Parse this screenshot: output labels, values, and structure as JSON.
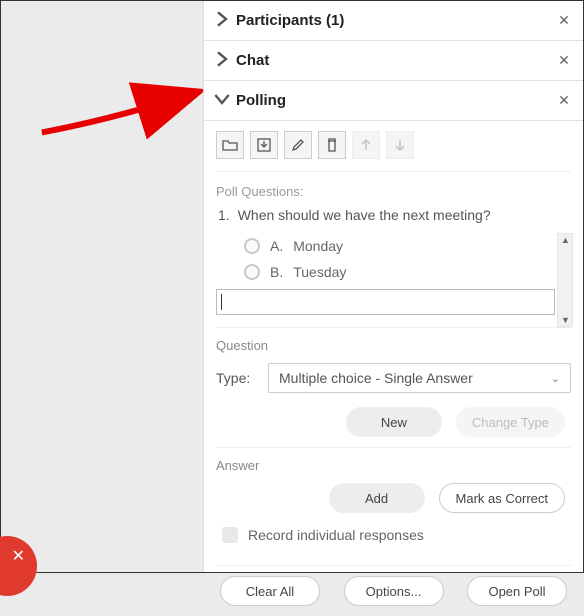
{
  "sections": {
    "participants": {
      "title": "Participants (1)"
    },
    "chat": {
      "title": "Chat"
    },
    "polling": {
      "title": "Polling"
    }
  },
  "polling": {
    "questions_label": "Poll Questions:",
    "question_number": "1.",
    "question_text": "When should we have the next meeting?",
    "options": [
      {
        "letter": "A.",
        "text": "Monday"
      },
      {
        "letter": "B.",
        "text": "Tuesday"
      }
    ],
    "question_section_label": "Question",
    "type_label": "Type:",
    "type_value": "Multiple choice - Single Answer",
    "new_btn": "New",
    "change_type_btn": "Change Type",
    "answer_section_label": "Answer",
    "add_btn": "Add",
    "mark_correct_btn": "Mark as Correct",
    "record_checkbox": "Record individual responses",
    "clear_all_btn": "Clear All",
    "options_btn": "Options...",
    "open_poll_btn": "Open Poll"
  }
}
